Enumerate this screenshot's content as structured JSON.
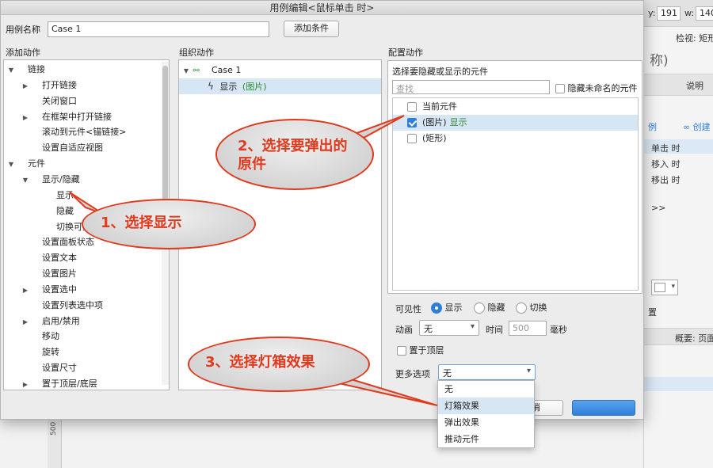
{
  "dialog": {
    "title": "用例编辑<鼠标单击 时>",
    "case_name_label": "用例名称",
    "case_name_value": "Case 1",
    "add_condition_button": "添加条件"
  },
  "add_actions": {
    "header": "添加动作",
    "items": [
      {
        "label": "链接",
        "level": 0,
        "arrow": "down"
      },
      {
        "label": "打开链接",
        "level": 1,
        "arrow": "right"
      },
      {
        "label": "关闭窗口",
        "level": 1,
        "arrow": ""
      },
      {
        "label": "在框架中打开链接",
        "level": 1,
        "arrow": "right"
      },
      {
        "label": "滚动到元件<锚链接>",
        "level": 1,
        "arrow": ""
      },
      {
        "label": "设置自适应视图",
        "level": 1,
        "arrow": ""
      },
      {
        "label": "元件",
        "level": 0,
        "arrow": "down"
      },
      {
        "label": "显示/隐藏",
        "level": 1,
        "arrow": "down"
      },
      {
        "label": "显示",
        "level": 2,
        "arrow": ""
      },
      {
        "label": "隐藏",
        "level": 2,
        "arrow": ""
      },
      {
        "label": "切换可见性",
        "level": 2,
        "arrow": ""
      },
      {
        "label": "设置面板状态",
        "level": 1,
        "arrow": ""
      },
      {
        "label": "设置文本",
        "level": 1,
        "arrow": ""
      },
      {
        "label": "设置图片",
        "level": 1,
        "arrow": ""
      },
      {
        "label": "设置选中",
        "level": 1,
        "arrow": "right"
      },
      {
        "label": "设置列表选中项",
        "level": 1,
        "arrow": ""
      },
      {
        "label": "启用/禁用",
        "level": 1,
        "arrow": "right"
      },
      {
        "label": "移动",
        "level": 1,
        "arrow": ""
      },
      {
        "label": "旋转",
        "level": 1,
        "arrow": ""
      },
      {
        "label": "设置尺寸",
        "level": 1,
        "arrow": ""
      },
      {
        "label": "置于顶层/底层",
        "level": 1,
        "arrow": "right"
      }
    ]
  },
  "organize_actions": {
    "header": "组织动作",
    "case_label": "Case 1",
    "action_verb": "显示",
    "action_target": "(图片)"
  },
  "configure_actions": {
    "header": "配置动作",
    "subtitle": "选择要隐藏或显示的元件",
    "search_placeholder": "查找",
    "hide_unnamed_label": "隐藏未命名的元件",
    "widgets": [
      {
        "label": "当前元件",
        "status": "",
        "checked": false
      },
      {
        "label": "(图片)",
        "status": "显示",
        "checked": true
      },
      {
        "label": "(矩形)",
        "status": "",
        "checked": false
      }
    ],
    "visibility_label": "可见性",
    "visibility_options": [
      "显示",
      "隐藏",
      "切换"
    ],
    "animation_label": "动画",
    "animation_value": "无",
    "time_label": "时间",
    "time_value": "500",
    "time_unit": "毫秒",
    "bring_to_front_label": "置于顶层",
    "more_options_label": "更多选项",
    "more_options_value": "无",
    "dropdown_options": [
      "无",
      "灯箱效果",
      "弹出效果",
      "推动元件"
    ],
    "cancel_fragment": "消"
  },
  "callouts": {
    "step1": "1、选择显示",
    "step2_line1": "2、选择要弹出的",
    "step2_line2": "原件",
    "step3": "3、选择灯箱效果"
  },
  "background": {
    "y_label": "y:",
    "y_value": "191",
    "w_label": "w:",
    "w_value": "140",
    "inspect_label": "检视: 矩形",
    "name_fragment": "称)",
    "description_tab": "说明",
    "link_fragment": "例",
    "create_link": "创建",
    "event_click": "单击 时",
    "event_enter": "移入 时",
    "event_leave": "移出 时",
    "arrows": ">>",
    "position_fragment": "置",
    "summary_label": "概要: 页面",
    "ruler_mark": "500"
  },
  "colors": {
    "callout_border": "#e03a1e",
    "selection": "#d7e6f4",
    "accent": "#2f7fd9",
    "status_green": "#2e8b2e"
  }
}
